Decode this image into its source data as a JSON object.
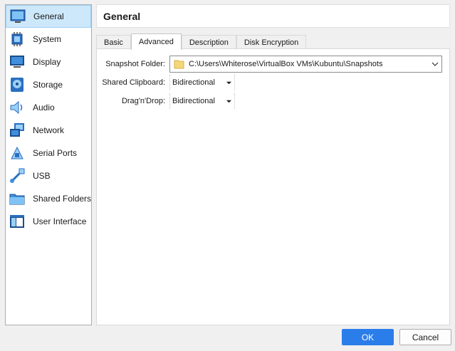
{
  "sidebar": {
    "items": [
      {
        "label": "General",
        "icon": "general-icon",
        "selected": true
      },
      {
        "label": "System",
        "icon": "system-chip-icon"
      },
      {
        "label": "Display",
        "icon": "display-monitor-icon"
      },
      {
        "label": "Storage",
        "icon": "storage-disk-icon"
      },
      {
        "label": "Audio",
        "icon": "audio-speaker-icon"
      },
      {
        "label": "Network",
        "icon": "network-icon"
      },
      {
        "label": "Serial Ports",
        "icon": "serial-port-icon"
      },
      {
        "label": "USB",
        "icon": "usb-icon"
      },
      {
        "label": "Shared Folders",
        "icon": "shared-folder-icon"
      },
      {
        "label": "User Interface",
        "icon": "user-interface-icon"
      }
    ]
  },
  "header": {
    "title": "General"
  },
  "tabs": [
    {
      "label": "Basic"
    },
    {
      "label": "Advanced",
      "active": true
    },
    {
      "label": "Description"
    },
    {
      "label": "Disk Encryption"
    }
  ],
  "form": {
    "snapshot_folder": {
      "label": "Snapshot Folder:",
      "value": "C:\\Users\\Whiterose\\VirtualBox VMs\\Kubuntu\\Snapshots"
    },
    "shared_clipboard": {
      "label": "Shared Clipboard:",
      "value": "Bidirectional"
    },
    "drag_n_drop": {
      "label": "Drag'n'Drop:",
      "value": "Bidirectional"
    }
  },
  "buttons": {
    "ok": "OK",
    "cancel": "Cancel"
  },
  "colors": {
    "accent": "#2b7de9",
    "selection": "#cde8fb",
    "folder": "#f5d77a"
  }
}
